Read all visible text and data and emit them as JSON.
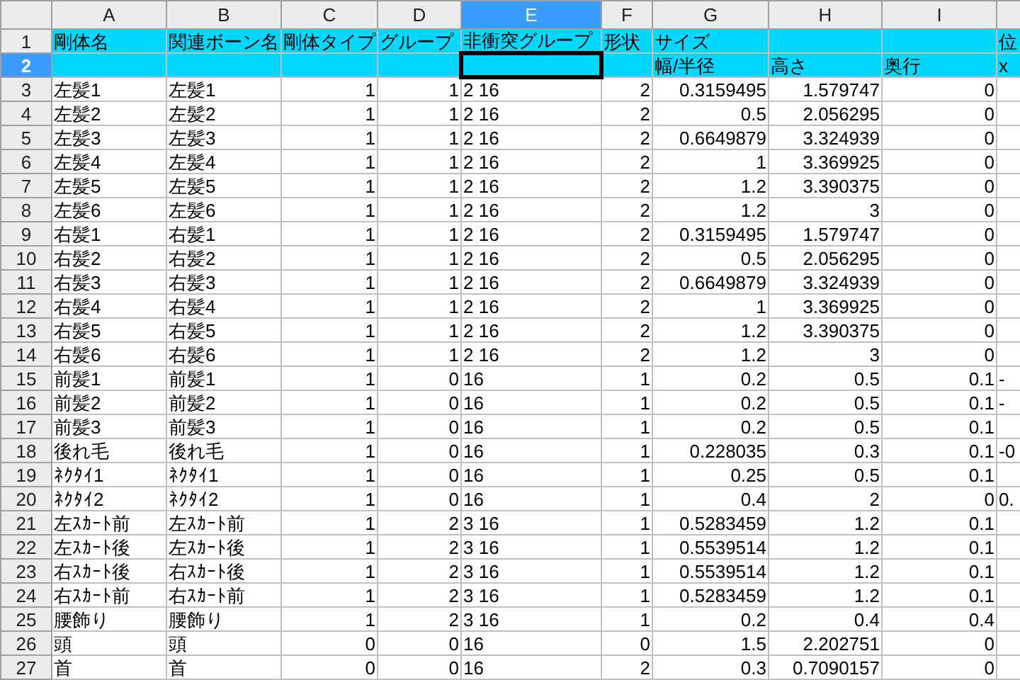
{
  "columns": [
    {
      "label": "A",
      "kind": "text",
      "selected": false
    },
    {
      "label": "B",
      "kind": "text",
      "selected": false
    },
    {
      "label": "C",
      "kind": "number",
      "selected": false
    },
    {
      "label": "D",
      "kind": "number",
      "selected": false
    },
    {
      "label": "E",
      "kind": "text",
      "selected": true
    },
    {
      "label": "F",
      "kind": "number",
      "selected": false
    },
    {
      "label": "G",
      "kind": "number",
      "selected": false
    },
    {
      "label": "H",
      "kind": "number",
      "selected": false
    },
    {
      "label": "I",
      "kind": "number",
      "selected": false
    },
    {
      "kind": "cut",
      "selected": false
    }
  ],
  "rows": [
    {
      "number": "1",
      "kind": "header",
      "selected": false,
      "cells": [
        "剛体名",
        "関連ボーン名",
        "剛体タイプ",
        "グループ",
        "非衝突グループ",
        "形状",
        "サイズ",
        "",
        "",
        "位"
      ]
    },
    {
      "number": "2",
      "kind": "header",
      "selected": true,
      "cells": [
        "",
        "",
        "",
        "",
        "",
        "",
        "幅/半径",
        "高さ",
        "奥行",
        "x"
      ]
    },
    {
      "number": "3",
      "kind": "data",
      "selected": false,
      "cells": [
        "左髪1",
        "左髪1",
        "1",
        "1",
        "2 16",
        "2",
        "0.3159495",
        "1.579747",
        "0",
        ""
      ]
    },
    {
      "number": "4",
      "kind": "data",
      "selected": false,
      "cells": [
        "左髪2",
        "左髪2",
        "1",
        "1",
        "2 16",
        "2",
        "0.5",
        "2.056295",
        "0",
        ""
      ]
    },
    {
      "number": "5",
      "kind": "data",
      "selected": false,
      "cells": [
        "左髪3",
        "左髪3",
        "1",
        "1",
        "2 16",
        "2",
        "0.6649879",
        "3.324939",
        "0",
        ""
      ]
    },
    {
      "number": "6",
      "kind": "data",
      "selected": false,
      "cells": [
        "左髪4",
        "左髪4",
        "1",
        "1",
        "2 16",
        "2",
        "1",
        "3.369925",
        "0",
        ""
      ]
    },
    {
      "number": "7",
      "kind": "data",
      "selected": false,
      "cells": [
        "左髪5",
        "左髪5",
        "1",
        "1",
        "2 16",
        "2",
        "1.2",
        "3.390375",
        "0",
        ""
      ]
    },
    {
      "number": "8",
      "kind": "data",
      "selected": false,
      "cells": [
        "左髪6",
        "左髪6",
        "1",
        "1",
        "2 16",
        "2",
        "1.2",
        "3",
        "0",
        ""
      ]
    },
    {
      "number": "9",
      "kind": "data",
      "selected": false,
      "cells": [
        "右髪1",
        "右髪1",
        "1",
        "1",
        "2 16",
        "2",
        "0.3159495",
        "1.579747",
        "0",
        ""
      ]
    },
    {
      "number": "10",
      "kind": "data",
      "selected": false,
      "cells": [
        "右髪2",
        "右髪2",
        "1",
        "1",
        "2 16",
        "2",
        "0.5",
        "2.056295",
        "0",
        ""
      ]
    },
    {
      "number": "11",
      "kind": "data",
      "selected": false,
      "cells": [
        "右髪3",
        "右髪3",
        "1",
        "1",
        "2 16",
        "2",
        "0.6649879",
        "3.324939",
        "0",
        ""
      ]
    },
    {
      "number": "12",
      "kind": "data",
      "selected": false,
      "cells": [
        "右髪4",
        "右髪4",
        "1",
        "1",
        "2 16",
        "2",
        "1",
        "3.369925",
        "0",
        ""
      ]
    },
    {
      "number": "13",
      "kind": "data",
      "selected": false,
      "cells": [
        "右髪5",
        "右髪5",
        "1",
        "1",
        "2 16",
        "2",
        "1.2",
        "3.390375",
        "0",
        ""
      ]
    },
    {
      "number": "14",
      "kind": "data",
      "selected": false,
      "cells": [
        "右髪6",
        "右髪6",
        "1",
        "1",
        "2 16",
        "2",
        "1.2",
        "3",
        "0",
        ""
      ]
    },
    {
      "number": "15",
      "kind": "data",
      "selected": false,
      "cells": [
        "前髪1",
        "前髪1",
        "1",
        "0",
        "16",
        "1",
        "0.2",
        "0.5",
        "0.1",
        "-"
      ]
    },
    {
      "number": "16",
      "kind": "data",
      "selected": false,
      "cells": [
        "前髪2",
        "前髪2",
        "1",
        "0",
        "16",
        "1",
        "0.2",
        "0.5",
        "0.1",
        "-"
      ]
    },
    {
      "number": "17",
      "kind": "data",
      "selected": false,
      "cells": [
        "前髪3",
        "前髪3",
        "1",
        "0",
        "16",
        "1",
        "0.2",
        "0.5",
        "0.1",
        ""
      ]
    },
    {
      "number": "18",
      "kind": "data",
      "selected": false,
      "cells": [
        "後れ毛",
        "後れ毛",
        "1",
        "0",
        "16",
        "1",
        "0.228035",
        "0.3",
        "0.1",
        "-0"
      ]
    },
    {
      "number": "19",
      "kind": "data",
      "selected": false,
      "cells": [
        "ﾈｸﾀｲ1",
        "ﾈｸﾀｲ1",
        "1",
        "0",
        "16",
        "1",
        "0.25",
        "0.5",
        "0.1",
        ""
      ]
    },
    {
      "number": "20",
      "kind": "data",
      "selected": false,
      "cells": [
        "ﾈｸﾀｲ2",
        "ﾈｸﾀｲ2",
        "1",
        "0",
        "16",
        "1",
        "0.4",
        "2",
        "0",
        "0."
      ]
    },
    {
      "number": "21",
      "kind": "data",
      "selected": false,
      "cells": [
        "左ｽｶｰﾄ前",
        "左ｽｶｰﾄ前",
        "1",
        "2",
        "3 16",
        "1",
        "0.5283459",
        "1.2",
        "0.1",
        ""
      ]
    },
    {
      "number": "22",
      "kind": "data",
      "selected": false,
      "cells": [
        "左ｽｶｰﾄ後",
        "左ｽｶｰﾄ後",
        "1",
        "2",
        "3 16",
        "1",
        "0.5539514",
        "1.2",
        "0.1",
        ""
      ]
    },
    {
      "number": "23",
      "kind": "data",
      "selected": false,
      "cells": [
        "右ｽｶｰﾄ後",
        "右ｽｶｰﾄ後",
        "1",
        "2",
        "3 16",
        "1",
        "0.5539514",
        "1.2",
        "0.1",
        ""
      ]
    },
    {
      "number": "24",
      "kind": "data",
      "selected": false,
      "cells": [
        "右ｽｶｰﾄ前",
        "右ｽｶｰﾄ前",
        "1",
        "2",
        "3 16",
        "1",
        "0.5283459",
        "1.2",
        "0.1",
        ""
      ]
    },
    {
      "number": "25",
      "kind": "data",
      "selected": false,
      "cells": [
        "腰飾り",
        "腰飾り",
        "1",
        "2",
        "3 16",
        "1",
        "0.2",
        "0.4",
        "0.4",
        ""
      ]
    },
    {
      "number": "26",
      "kind": "data",
      "selected": false,
      "cells": [
        "頭",
        "頭",
        "0",
        "0",
        "16",
        "0",
        "1.5",
        "2.202751",
        "0",
        ""
      ]
    },
    {
      "number": "27",
      "kind": "data",
      "selected": false,
      "cells": [
        "首",
        "首",
        "0",
        "0",
        "16",
        "2",
        "0.3",
        "0.7090157",
        "0",
        ""
      ]
    }
  ]
}
